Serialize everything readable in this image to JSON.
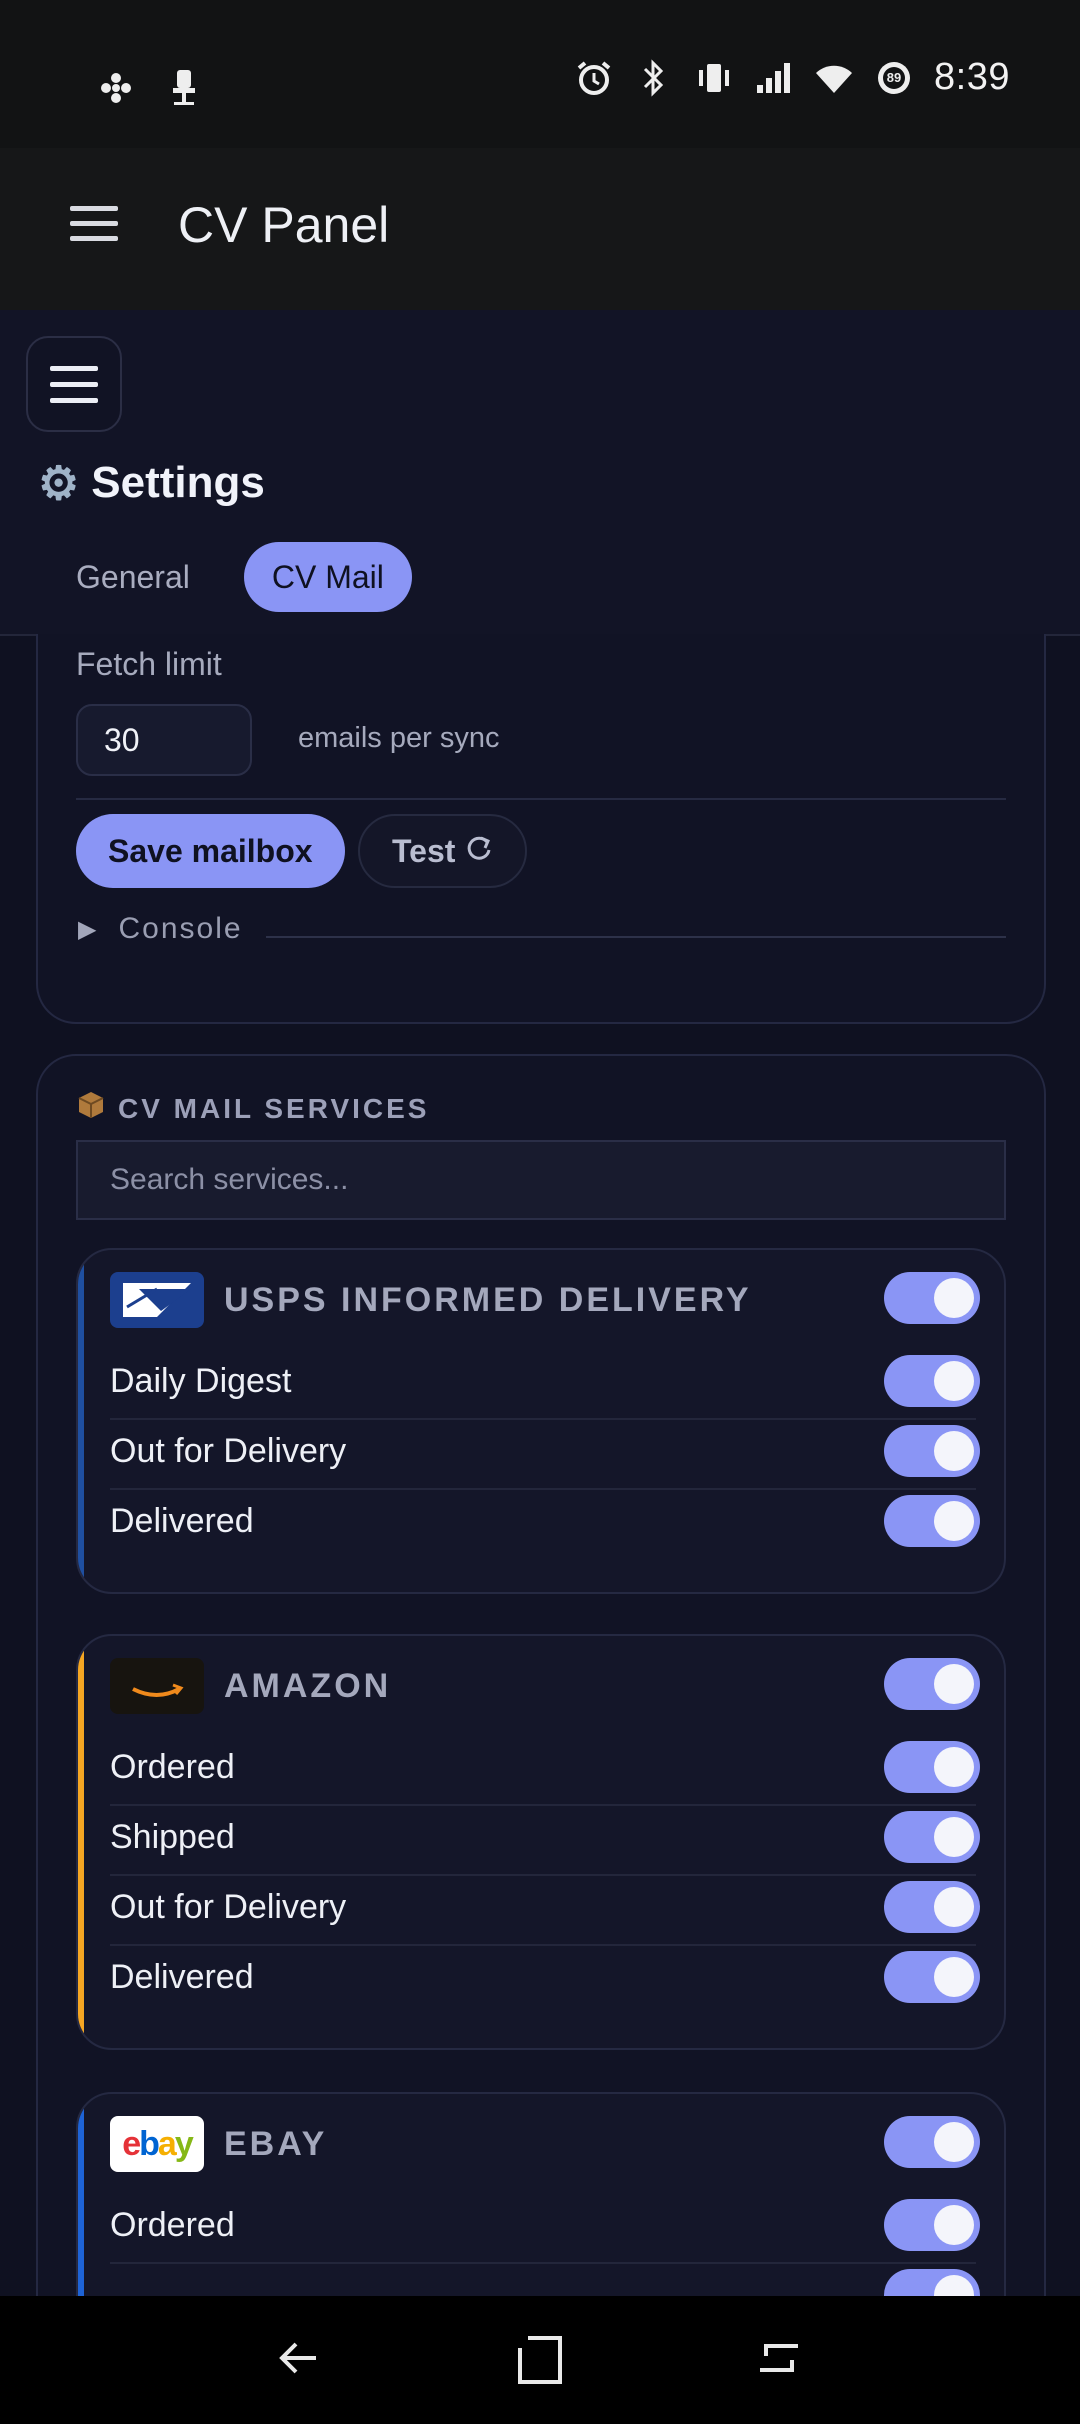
{
  "status_bar": {
    "time": "8:39",
    "battery_level": "89",
    "left_icons": [
      "fan-icon",
      "chair-icon"
    ],
    "right_icons": [
      "alarm-icon",
      "bluetooth-icon",
      "vibrate-icon",
      "signal-icon",
      "wifi-icon",
      "battery-icon"
    ]
  },
  "app_bar": {
    "title": "CV Panel",
    "menu_icon": "hamburger-icon"
  },
  "settings": {
    "title": "Settings",
    "title_icon": "gear-icon",
    "tabs": [
      {
        "label": "General",
        "active": false
      },
      {
        "label": "CV Mail",
        "active": true
      }
    ]
  },
  "mailbox": {
    "fetch_limit_label": "Fetch limit",
    "fetch_limit_value": "30",
    "fetch_limit_unit": "emails per sync",
    "save_label": "Save mailbox",
    "test_label": "Test",
    "console_label": "Console"
  },
  "services": {
    "title": "CV MAIL SERVICES",
    "title_icon": "package-icon",
    "search_placeholder": "Search services...",
    "items": [
      {
        "name": "USPS INFORMED DELIVERY",
        "logo": "usps-eagle-logo",
        "accent": "#1f4fa0",
        "enabled": true,
        "events": [
          {
            "label": "Daily Digest",
            "enabled": true
          },
          {
            "label": "Out for Delivery",
            "enabled": true
          },
          {
            "label": "Delivered",
            "enabled": true
          }
        ]
      },
      {
        "name": "AMAZON",
        "logo": "amazon-logo",
        "accent": "#f5a623",
        "enabled": true,
        "events": [
          {
            "label": "Ordered",
            "enabled": true
          },
          {
            "label": "Shipped",
            "enabled": true
          },
          {
            "label": "Out for Delivery",
            "enabled": true
          },
          {
            "label": "Delivered",
            "enabled": true
          }
        ]
      },
      {
        "name": "EBAY",
        "logo": "ebay-logo",
        "logo_text": "ebay",
        "accent": "#1e63d6",
        "enabled": true,
        "events": [
          {
            "label": "Ordered",
            "enabled": true
          }
        ]
      }
    ]
  },
  "colors": {
    "accent": "#8a95f5",
    "background": "#0f1121",
    "card": "#111325"
  },
  "nav_bar": {
    "icons": [
      "back-icon",
      "home-icon",
      "recents-icon"
    ]
  }
}
